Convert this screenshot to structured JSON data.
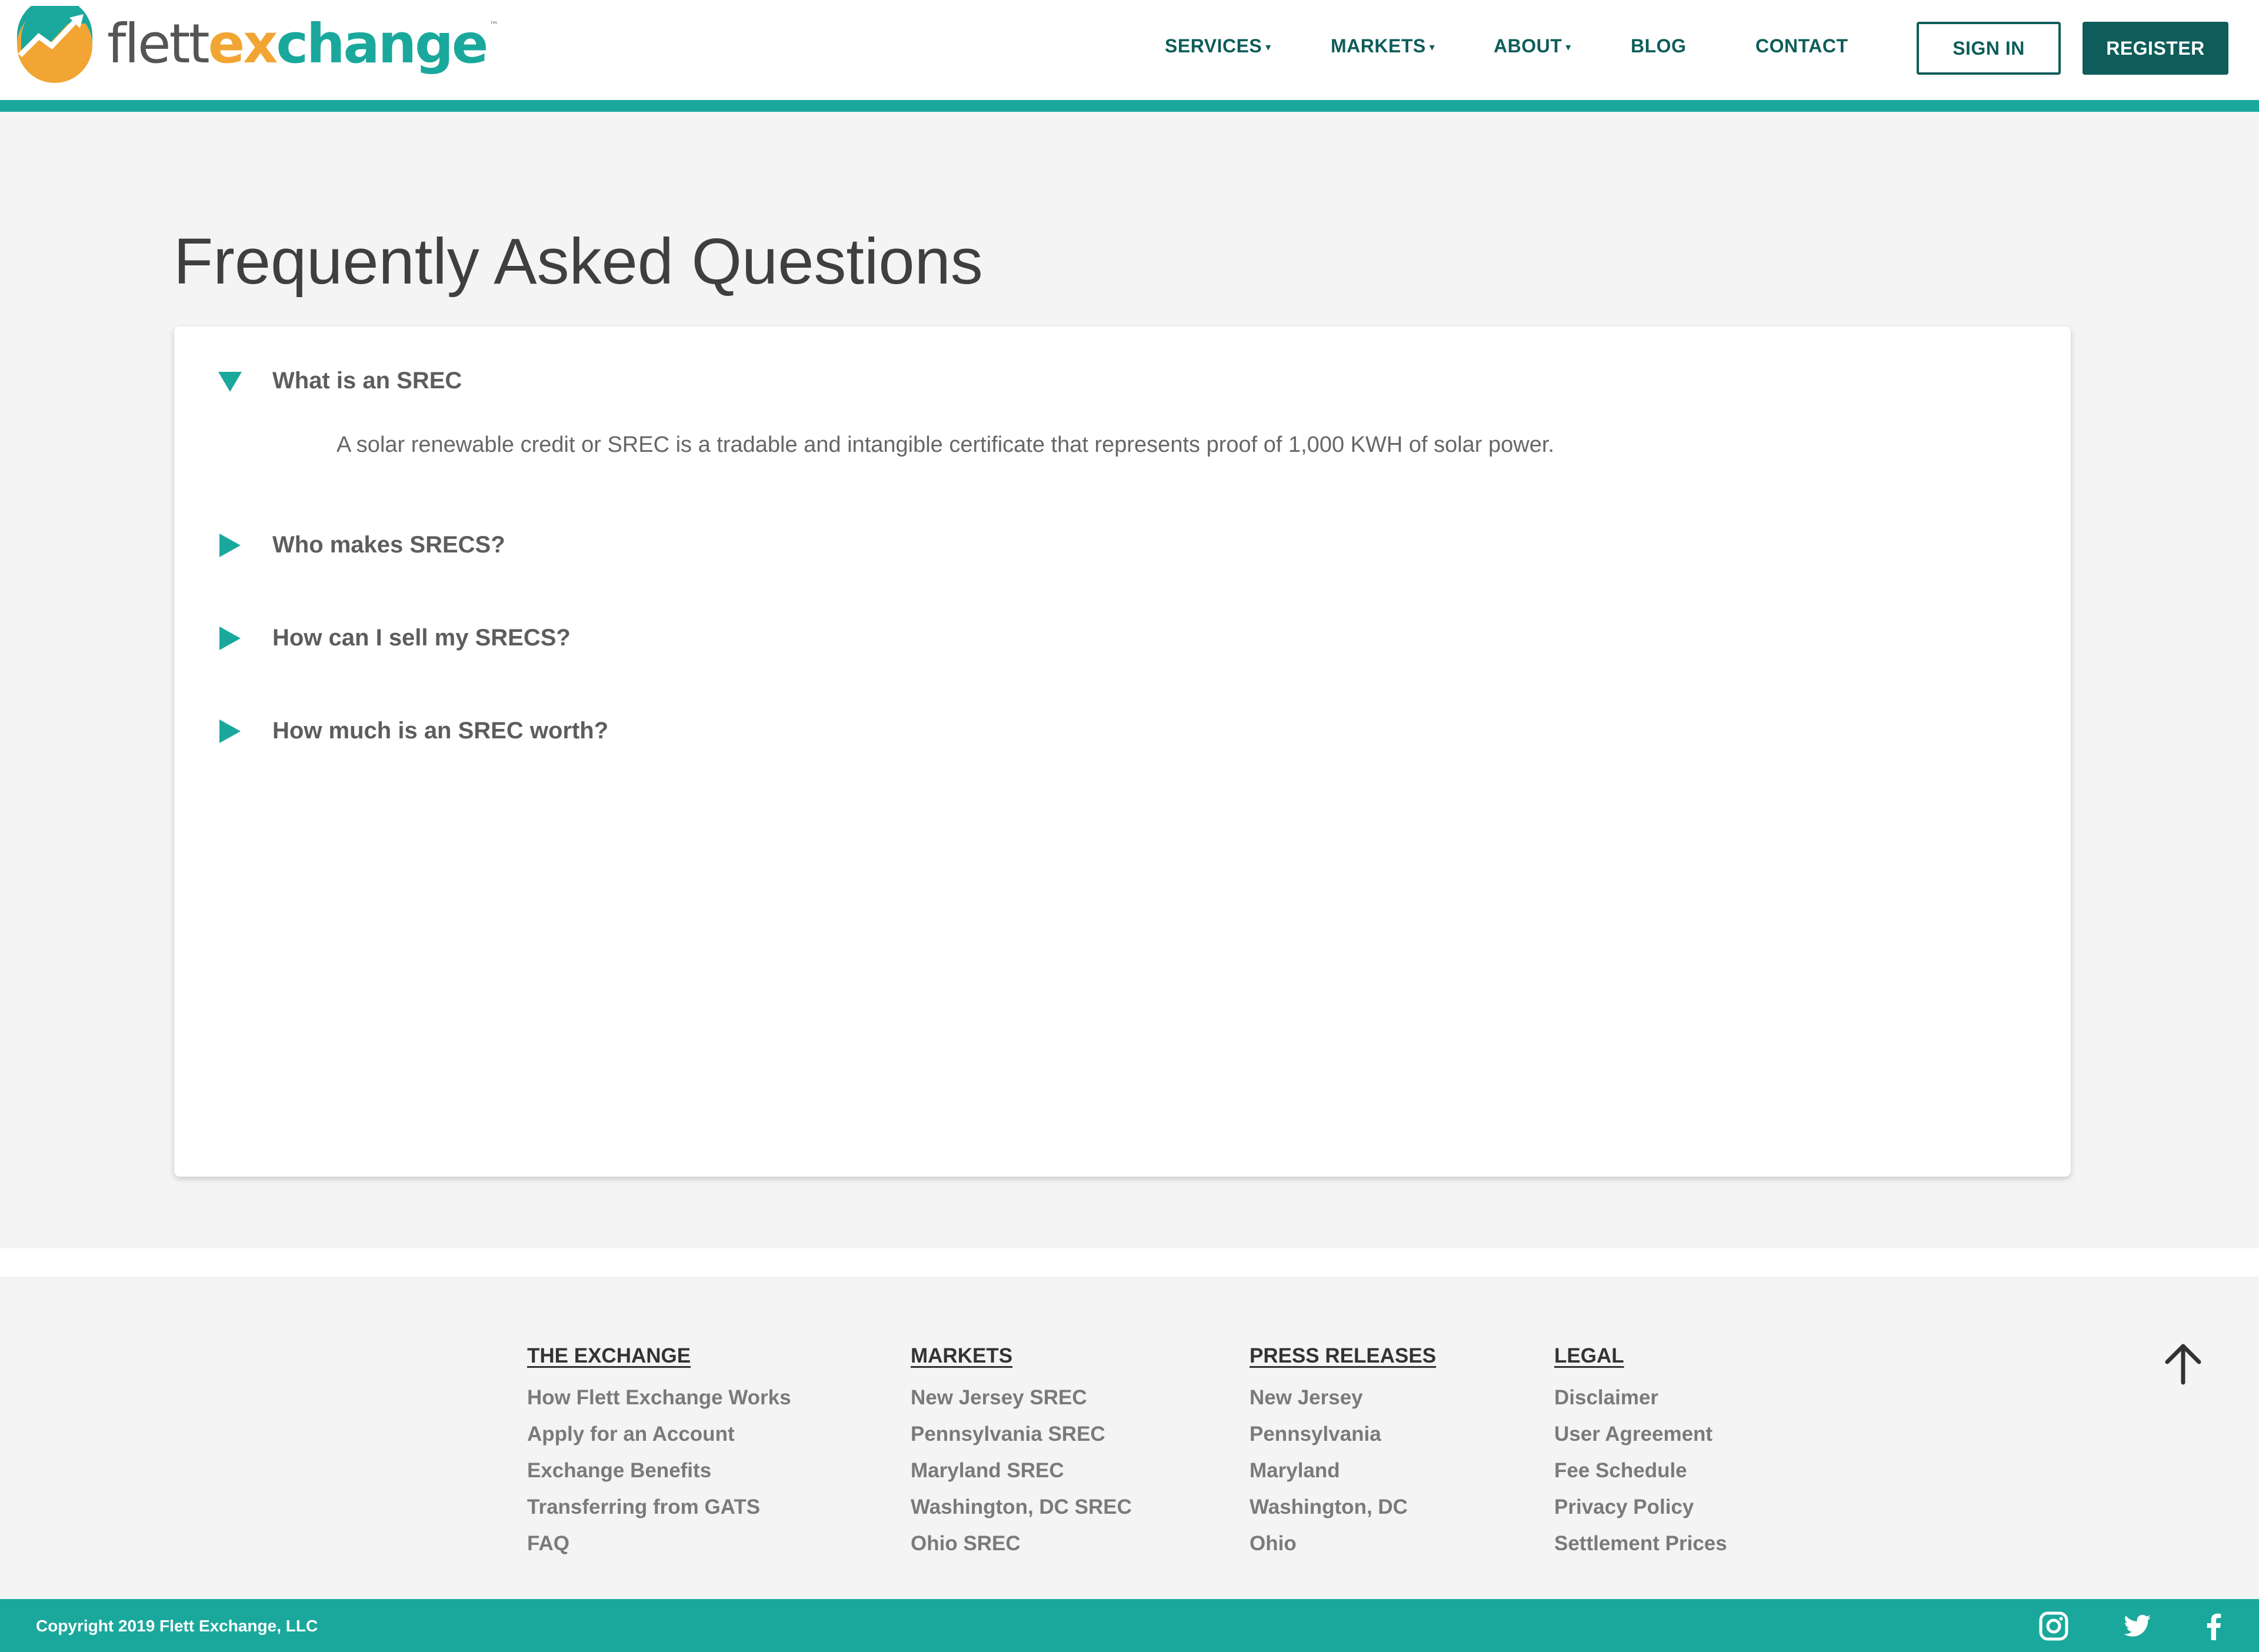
{
  "header": {
    "logo": {
      "part1": "flett",
      "part2": "ex",
      "part3": "change",
      "tm": "™"
    },
    "nav": [
      {
        "label": "SERVICES",
        "caret": "▾"
      },
      {
        "label": "MARKETS",
        "caret": "▾"
      },
      {
        "label": "ABOUT",
        "caret": "▾"
      },
      {
        "label": "BLOG"
      },
      {
        "label": "CONTACT"
      }
    ],
    "signin_label": "SIGN IN",
    "register_label": "REGISTER"
  },
  "main": {
    "title": "Frequently Asked Questions",
    "faq": [
      {
        "question": "What is an SREC",
        "expanded": true,
        "answer": "A solar renewable credit or SREC is a tradable and intangible certificate that represents proof of 1,000 KWH of solar power."
      },
      {
        "question": "Who makes SRECS?",
        "expanded": false
      },
      {
        "question": "How can I sell my SRECS?",
        "expanded": false
      },
      {
        "question": "How much is an SREC worth?",
        "expanded": false
      }
    ]
  },
  "footer": {
    "columns": [
      {
        "heading": "THE EXCHANGE",
        "links": [
          "How Flett Exchange Works",
          "Apply for an Account",
          "Exchange Benefits",
          "Transferring from GATS",
          "FAQ"
        ]
      },
      {
        "heading": "MARKETS",
        "links": [
          "New Jersey SREC",
          "Pennsylvania SREC",
          "Maryland SREC",
          "Washington, DC SREC",
          "Ohio SREC"
        ]
      },
      {
        "heading": "PRESS RELEASES",
        "links": [
          "New Jersey",
          "Pennsylvania",
          "Maryland",
          "Washington, DC",
          "Ohio"
        ]
      },
      {
        "heading": "LEGAL",
        "links": [
          "Disclaimer",
          "User Agreement",
          "Fee Schedule",
          "Privacy Policy",
          "Settlement Prices"
        ]
      }
    ],
    "back_to_top_icon": "arrow-up-icon",
    "copyright": "Copyright 2019 Flett Exchange, LLC",
    "social_icons": [
      "instagram-icon",
      "twitter-icon",
      "facebook-icon"
    ]
  },
  "colors": {
    "teal": "#1aa89c",
    "dark_teal": "#0e5d5a",
    "orange": "#f2a533",
    "background": "#f4f4f4"
  }
}
